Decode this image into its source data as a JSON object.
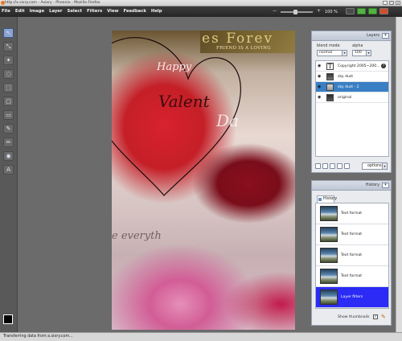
{
  "window": {
    "title": "http://x.sixry.com - Aviary - Phoenix - Mozilla Firefox",
    "controls": [
      "_",
      "□",
      "×"
    ]
  },
  "menu": [
    "File",
    "Edit",
    "Image",
    "Layer",
    "Select",
    "Filters",
    "View",
    "Feedback",
    "Help"
  ],
  "zoom": {
    "minus": "−",
    "plus": "+",
    "value": "100 %"
  },
  "tools": [
    {
      "name": "pointer-tool-icon",
      "glyph": "↖"
    },
    {
      "name": "transform-tool-icon",
      "glyph": "⤡"
    },
    {
      "name": "magic-wand-tool-icon",
      "glyph": "✦"
    },
    {
      "name": "lasso-tool-icon",
      "glyph": "◌"
    },
    {
      "name": "marquee-tool-icon",
      "glyph": "⬚"
    },
    {
      "name": "text-bubble-tool-icon",
      "glyph": "▢"
    },
    {
      "name": "eraser-tool-icon",
      "glyph": "▭"
    },
    {
      "name": "brush-tool-icon",
      "glyph": "✎"
    },
    {
      "name": "pencil-tool-icon",
      "glyph": "✏"
    },
    {
      "name": "fill-tool-icon",
      "glyph": "◉"
    },
    {
      "name": "text-tool-icon",
      "glyph": "A"
    }
  ],
  "canvas": {
    "banner": "es Forev",
    "banner_sub": "FRIEND IS A LOVING",
    "happy": "Happy",
    "valent": "Valent",
    "da": "Da",
    "every": "e everyth"
  },
  "layers_panel": {
    "title": "Layers",
    "blend_label": "blend mode",
    "blend_value": "normal",
    "alpha_label": "alpha",
    "alpha_value": "100",
    "options_label": "options",
    "layers": [
      {
        "name": "Copyright 2005~200...",
        "type": "text",
        "active": false
      },
      {
        "name": "sky dust",
        "type": "image",
        "active": false
      },
      {
        "name": "sky dust - 2",
        "type": "image",
        "active": true
      },
      {
        "name": "original",
        "type": "image",
        "active": false
      }
    ]
  },
  "history_panel": {
    "title": "History",
    "tab_label": "History",
    "show_thumbnails_label": "Show thumbnails",
    "show_thumbnails_checked": "✓",
    "items": [
      {
        "label": "Text format",
        "active": false
      },
      {
        "label": "Text format",
        "active": false
      },
      {
        "label": "Text format",
        "active": false
      },
      {
        "label": "Text format",
        "active": false
      },
      {
        "label": "Layer filters",
        "active": true
      }
    ]
  },
  "status": "Transferring data from a.sixry.com..."
}
